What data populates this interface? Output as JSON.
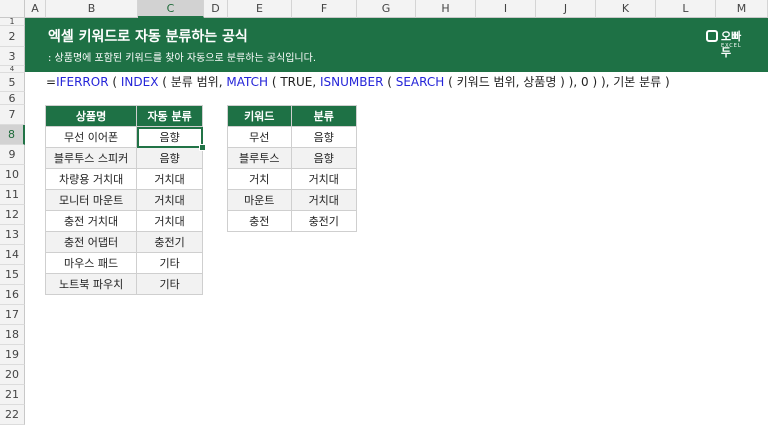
{
  "columns": [
    "A",
    "B",
    "C",
    "D",
    "E",
    "F",
    "G",
    "H",
    "I",
    "J",
    "K",
    "L",
    "M"
  ],
  "rows": [
    "1",
    "2",
    "3",
    "4",
    "5",
    "6",
    "7",
    "8",
    "9",
    "10",
    "11",
    "12",
    "13",
    "14",
    "15",
    "16",
    "17",
    "18",
    "19",
    "20",
    "21",
    "22"
  ],
  "selected_column": "C",
  "selected_row": "8",
  "banner": {
    "title": "엑셀 키워드로 자동 분류하는 공식",
    "subtitle": ": 상품명에 포함된 키워드를 찾아 자동으로 분류하는 공식입니다.",
    "logo_text": "오빠두",
    "logo_sub": "EXCEL"
  },
  "formula": {
    "eq": "=",
    "f1": "IFERROR",
    "p1": " ( ",
    "f2": "INDEX",
    "p2": " ( 분류 범위, ",
    "f3": "MATCH",
    "p3": " ( TRUE, ",
    "f4": "ISNUMBER",
    "p4": " ( ",
    "f5": "SEARCH",
    "p5": " ( 키워드 범위, 상품명 ) ), 0 ) ), 기본 분류 )"
  },
  "left_table": {
    "headers": [
      "상품명",
      "자동 분류"
    ],
    "rows": [
      [
        "무선 이어폰",
        "음향"
      ],
      [
        "블루투스 스피커",
        "음향"
      ],
      [
        "차량용 거치대",
        "거치대"
      ],
      [
        "모니터 마운트",
        "거치대"
      ],
      [
        "충전 거치대",
        "거치대"
      ],
      [
        "충전 어댑터",
        "충전기"
      ],
      [
        "마우스 패드",
        "기타"
      ],
      [
        "노트북 파우치",
        "기타"
      ]
    ]
  },
  "right_table": {
    "headers": [
      "키워드",
      "분류"
    ],
    "rows": [
      [
        "무선",
        "음향"
      ],
      [
        "블루투스",
        "음향"
      ],
      [
        "거치",
        "거치대"
      ],
      [
        "마운트",
        "거치대"
      ],
      [
        "충전",
        "충전기"
      ]
    ]
  },
  "colors": {
    "header_green": "#1e7145",
    "selection_green": "#217346",
    "function_blue": "#2424d8"
  }
}
